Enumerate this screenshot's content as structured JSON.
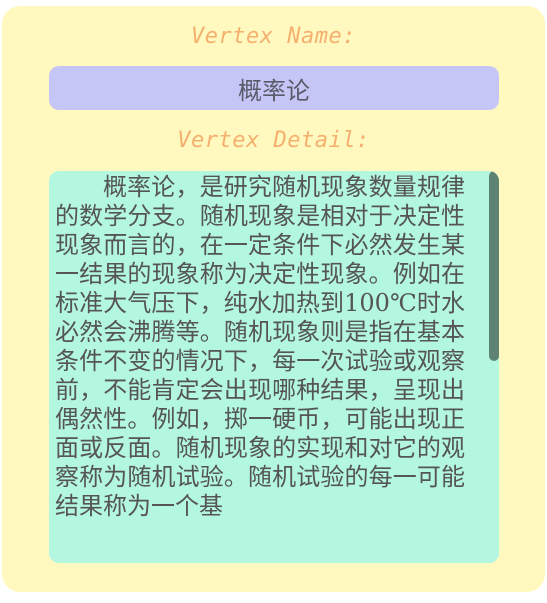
{
  "vertex_name": {
    "label": "Vertex Name:",
    "value": "概率论"
  },
  "vertex_detail": {
    "label": "Vertex Detail:",
    "text": "概率论，是研究随机现象数量规律的数学分支。随机现象是相对于决定性现象而言的，在一定条件下必然发生某一结果的现象称为决定性现象。例如在标准大气压下，纯水加热到100℃时水必然会沸腾等。随机现象则是指在基本条件不变的情况下，每一次试验或观察前，不能肯定会出现哪种结果，呈现出偶然性。例如，掷一硬币，可能出现正面或反面。随机现象的实现和对它的观察称为随机试验。随机试验的每一可能结果称为一个基"
  },
  "colors": {
    "panel_background": "#fff9bf",
    "label_color": "#f5b06f",
    "name_box": "#c6c6f6",
    "detail_box": "#b3f7e1",
    "scrollbar_thumb": "#5e8373"
  }
}
